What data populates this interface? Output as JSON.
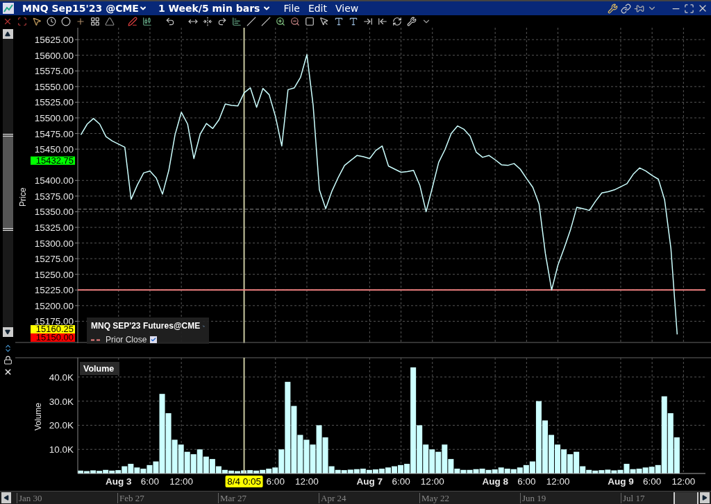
{
  "window": {
    "title": "MNQ Sep15'23 @CME",
    "period": "1 Week/5 min bars",
    "menus": [
      "File",
      "Edit",
      "View"
    ]
  },
  "price_pane": {
    "legend": {
      "items": [
        {
          "label": "Prior Close",
          "checked": true,
          "color": "#f08080"
        }
      ]
    },
    "tags": [
      {
        "label": "15432.75",
        "color": "#00ff00"
      },
      {
        "label": "15160.25",
        "color": "#ffff00"
      },
      {
        "label": "15150.00",
        "color": "#ff0000"
      }
    ],
    "chart_data": {
      "type": "line",
      "ylabel": "Price",
      "ylim": [
        15140,
        15644
      ],
      "grid": true,
      "categories": [
        null,
        null,
        null,
        null,
        null,
        null,
        null,
        null,
        null,
        null,
        null,
        null,
        null,
        null,
        null,
        null,
        null,
        null,
        null,
        null,
        null,
        null,
        null,
        null,
        null,
        null,
        null,
        null,
        null,
        null,
        null,
        null,
        null,
        null,
        null,
        null,
        null,
        null,
        null,
        null,
        null,
        null,
        null,
        null,
        null,
        null,
        null,
        null,
        null,
        null,
        null,
        null,
        null,
        null,
        null,
        null,
        null,
        null,
        null,
        null,
        null,
        null,
        null,
        null,
        null,
        null,
        null,
        null,
        null,
        null,
        null,
        null,
        null,
        null,
        null,
        null,
        null,
        null,
        null,
        null,
        null,
        null,
        null,
        null,
        null,
        null,
        null,
        null,
        null,
        null,
        null,
        null,
        null,
        null,
        null,
        null,
        null,
        null,
        null,
        null
      ],
      "series": [
        {
          "name": "MNQ SEP'23 Futures@CME",
          "color": "#ccffff",
          "values": [
            15473,
            15490,
            15499,
            15490,
            15470,
            15463,
            15458,
            15453,
            15370,
            15393,
            15412,
            15415,
            15404,
            15378,
            15416,
            15473,
            15509,
            15490,
            15435,
            15474,
            15491,
            15483,
            15497,
            15522,
            15520,
            15519,
            15540,
            15548,
            15517,
            15547,
            15537,
            15502,
            15455,
            15545,
            15548,
            15565,
            15601,
            15520,
            15385,
            15355,
            15383,
            15405,
            15424,
            15432,
            15440,
            15438,
            15435,
            15448,
            15455,
            15423,
            15418,
            15413,
            15414,
            15416,
            15392,
            15350,
            15389,
            15429,
            15449,
            15475,
            15487,
            15482,
            15471,
            15445,
            15437,
            15440,
            15433,
            15425,
            15424,
            15427,
            15418,
            15403,
            15389,
            15362,
            15283,
            15225,
            15265,
            15292,
            15321,
            15357,
            15355,
            15352,
            15367,
            15380,
            15382,
            15385,
            15390,
            15395,
            15410,
            15420,
            15415,
            15408,
            15402,
            15369,
            15291,
            15154,
            null,
            null,
            null,
            null
          ]
        }
      ],
      "yticks": [
        {
          "value": 15625,
          "label": "15625.00"
        },
        {
          "value": 15600,
          "label": "15600.00"
        },
        {
          "value": 15575,
          "label": "15575.00"
        },
        {
          "value": 15550,
          "label": "15550.00"
        },
        {
          "value": 15525,
          "label": "15525.00"
        },
        {
          "value": 15500,
          "label": "15500.00"
        },
        {
          "value": 15475,
          "label": "15475.00"
        },
        {
          "value": 15450,
          "label": "15450.00"
        },
        {
          "value": 15400,
          "label": "15400.00"
        },
        {
          "value": 15375,
          "label": "15375.00"
        },
        {
          "value": 15350,
          "label": "15350.00"
        },
        {
          "value": 15325,
          "label": "15325.00"
        },
        {
          "value": 15300,
          "label": "15300.00"
        },
        {
          "value": 15275,
          "label": "15275.00"
        },
        {
          "value": 15250,
          "label": "15250.00"
        },
        {
          "value": 15225,
          "label": "15225.00"
        },
        {
          "value": 15200,
          "label": "15200.00"
        },
        {
          "value": 15175,
          "label": "15175.00"
        }
      ],
      "ref_lines": [
        {
          "axis": "y",
          "value": 15225,
          "color": "#f08080"
        },
        {
          "axis": "y",
          "value": 15354,
          "color": "#909090"
        }
      ]
    }
  },
  "volume_pane": {
    "chart_data": {
      "type": "bar",
      "ylabel": "Volume",
      "ylim": [
        0,
        48000
      ],
      "grid": true,
      "categories": [
        null,
        null,
        null,
        null,
        null,
        null,
        "Aug 3",
        null,
        null,
        null,
        null,
        "6:00",
        null,
        null,
        null,
        null,
        "12:00",
        null,
        null,
        null,
        null,
        null,
        null,
        null,
        null,
        null,
        "8/4 0:05",
        null,
        null,
        null,
        null,
        "6:00",
        null,
        null,
        null,
        null,
        "12:00",
        null,
        null,
        null,
        null,
        null,
        null,
        null,
        null,
        null,
        "Aug 7",
        null,
        null,
        null,
        null,
        "6:00",
        null,
        null,
        null,
        null,
        "12:00",
        null,
        null,
        null,
        null,
        null,
        null,
        null,
        null,
        null,
        "Aug 8",
        null,
        null,
        null,
        null,
        "6:00",
        null,
        null,
        null,
        null,
        "12:00",
        null,
        null,
        null,
        null,
        null,
        null,
        null,
        null,
        null,
        "Aug 9",
        null,
        null,
        null,
        null,
        "6:00",
        null,
        null,
        null,
        null,
        "12:00",
        null,
        null,
        null
      ],
      "series": [
        {
          "name": "Volume",
          "color": "#ccffff",
          "values": [
            1200,
            1000,
            1300,
            1100,
            1500,
            1200,
            1400,
            3000,
            4000,
            2500,
            2000,
            3500,
            5000,
            33000,
            25000,
            14000,
            12000,
            9000,
            8000,
            10000,
            7000,
            6000,
            3000,
            1500,
            1200,
            1000,
            1300,
            1400,
            1200,
            1500,
            2000,
            2500,
            10000,
            38000,
            28000,
            16000,
            14000,
            12000,
            20000,
            15000,
            3000,
            1500,
            1400,
            1600,
            1800,
            2000,
            1500,
            1700,
            2000,
            2500,
            3000,
            3500,
            4000,
            44000,
            20000,
            12000,
            10000,
            9000,
            12000,
            6000,
            2000,
            1500,
            1500,
            1800,
            2000,
            1500,
            1700,
            2500,
            2000,
            1800,
            2500,
            3500,
            5000,
            30000,
            22000,
            16000,
            12000,
            10000,
            8000,
            9000,
            3000,
            1500,
            1200,
            1400,
            1600,
            1300,
            1500,
            4000,
            1800,
            2000,
            2500,
            2800,
            3500,
            32000,
            25000,
            15000,
            null,
            null,
            null,
            null
          ]
        }
      ],
      "yticks": [
        {
          "value": 10000,
          "label": "10.0K"
        },
        {
          "value": 20000,
          "label": "20.0K"
        },
        {
          "value": 30000,
          "label": "30.0K"
        },
        {
          "value": 40000,
          "label": "40.0K"
        }
      ],
      "ref_lines": [
        {
          "axis": "x",
          "value": "8/4 0:05",
          "color": "#c8c8a0"
        }
      ]
    }
  },
  "navigator": {
    "labels": [
      "Jan 30",
      "Feb 27",
      "Mar 27",
      "Apr 24",
      "May 22",
      "Jun 19",
      "Jul 17"
    ]
  }
}
